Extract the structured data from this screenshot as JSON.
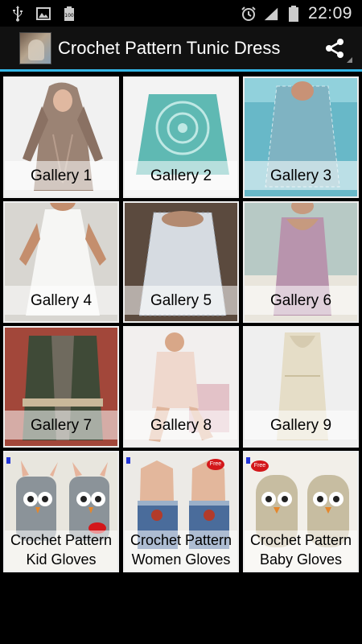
{
  "status_bar": {
    "time": "22:09",
    "icons": [
      "usb-icon",
      "image-icon",
      "battery-100-icon",
      "alarm-icon",
      "signal-icon",
      "battery-icon"
    ],
    "battery_small_label": "100"
  },
  "action_bar": {
    "title": "Crochet Pattern Tunic Dress",
    "accent_color": "#33b5e5",
    "share_icon": "share-icon"
  },
  "grid": {
    "items": [
      {
        "label": "Gallery 1"
      },
      {
        "label": "Gallery 2"
      },
      {
        "label": "Gallery 3"
      },
      {
        "label": "Gallery 4"
      },
      {
        "label": "Gallery 5"
      },
      {
        "label": "Gallery 6"
      },
      {
        "label": "Gallery 7"
      },
      {
        "label": "Gallery 8"
      },
      {
        "label": "Gallery 9"
      },
      {
        "line1": "Crochet Pattern",
        "line2": "Kid Gloves"
      },
      {
        "line1": "Crochet Pattern",
        "line2": "Women Gloves",
        "badge": "Free"
      },
      {
        "line1": "Crochet Pattern",
        "line2": "Baby Gloves",
        "badge": "Free"
      }
    ]
  }
}
